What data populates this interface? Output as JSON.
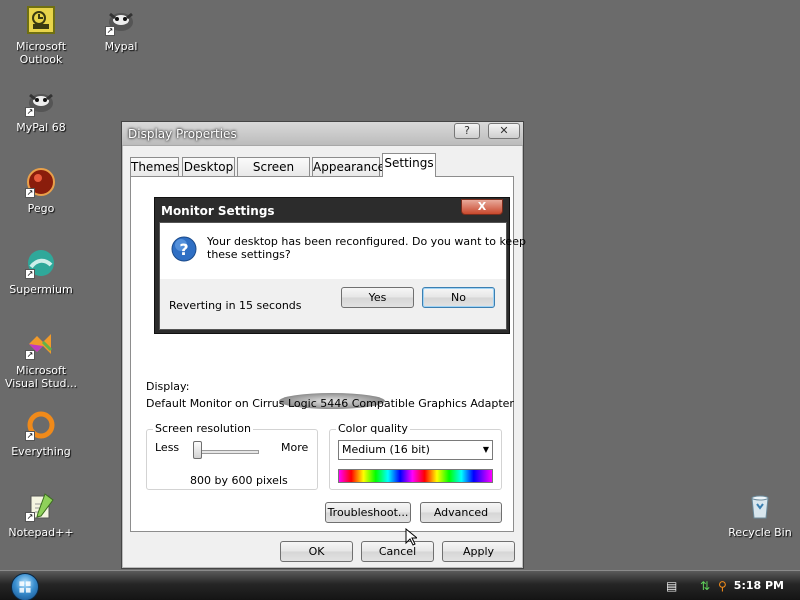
{
  "desktop": {
    "icons": [
      {
        "label_line1": "Microsoft",
        "label_line2": "Outlook",
        "icon": "outlook-icon"
      },
      {
        "label_line1": "Mypal",
        "label_line2": "",
        "icon": "mypal-icon"
      },
      {
        "label_line1": "MyPal 68",
        "label_line2": "",
        "icon": "mypal68-icon"
      },
      {
        "label_line1": "Pego",
        "label_line2": "",
        "icon": "pego-icon"
      },
      {
        "label_line1": "Supermium",
        "label_line2": "",
        "icon": "supermium-icon"
      },
      {
        "label_line1": "Microsoft",
        "label_line2": "Visual Stud...",
        "icon": "visual-studio-icon"
      },
      {
        "label_line1": "Everything",
        "label_line2": "",
        "icon": "everything-icon"
      },
      {
        "label_line1": "Notepad++",
        "label_line2": "",
        "icon": "notepadpp-icon"
      },
      {
        "label_line1": "Recycle Bin",
        "label_line2": "",
        "icon": "recycle-bin-icon"
      }
    ]
  },
  "display_properties": {
    "title": "Display Properties",
    "help_btn": "?",
    "close_btn": "✕",
    "tabs": [
      "Themes",
      "Desktop",
      "Screen Saver",
      "Appearance",
      "Settings"
    ],
    "active_tab": "Settings",
    "display_label": "Display:",
    "display_value": "Default Monitor on Cirrus Logic 5446 Compatible Graphics Adapter",
    "screen_resolution": {
      "title": "Screen resolution",
      "less": "Less",
      "more": "More",
      "value": "800 by 600 pixels",
      "slider_position": 0
    },
    "color_quality": {
      "title": "Color quality",
      "selected": "Medium (16 bit)"
    },
    "buttons": {
      "troubleshoot": "Troubleshoot...",
      "advanced": "Advanced",
      "ok": "OK",
      "cancel": "Cancel",
      "apply": "Apply"
    }
  },
  "monitor_settings": {
    "title": "Monitor Settings",
    "close": "X",
    "message_line1": "Your desktop has been reconfigured.  Do you want to keep",
    "message_line2": "these settings?",
    "reverting": "Reverting in 15 seconds",
    "yes": "Yes",
    "no": "No"
  },
  "taskbar": {
    "clock": "5:18 PM"
  },
  "colors": {
    "desktop_bg": "#6b6b6b",
    "dialog_frame": "#2c2c2c",
    "close_red": "#c9482c"
  }
}
